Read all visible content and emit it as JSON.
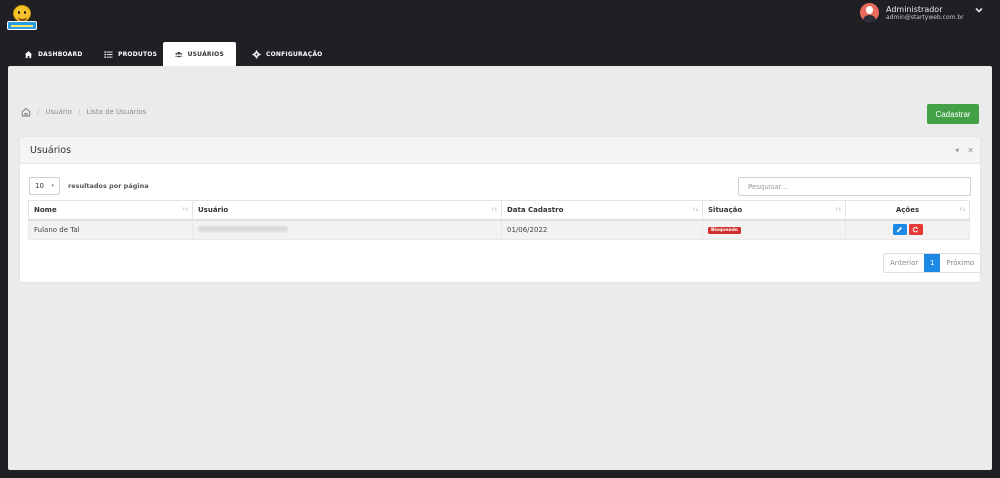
{
  "app": {
    "logo_name": "app-logo"
  },
  "user": {
    "name": "Administrador",
    "email": "admin@startyweb.com.br"
  },
  "nav": {
    "tabs": [
      {
        "label": "DASHBOARD",
        "icon": "home-icon"
      },
      {
        "label": "PRODUTOS",
        "icon": "list-icon"
      },
      {
        "label": "USUÁRIOS",
        "icon": "users-icon",
        "active": true
      },
      {
        "label": "CONFIGURAÇÃO",
        "icon": "gear-icon"
      }
    ]
  },
  "breadcrumb": {
    "items": [
      "Usuário",
      "Lista de Usuários"
    ]
  },
  "actions": {
    "cadastrar_label": "Cadastrar"
  },
  "card": {
    "title": "Usuários",
    "tools": {
      "collapse": "▾",
      "close": "✕"
    }
  },
  "table_controls": {
    "page_length": "10",
    "page_length_label": "resultados por página",
    "search_placeholder": "Pesquisar..."
  },
  "table": {
    "columns": [
      "Nome",
      "Usuário",
      "Data Cadastro",
      "Situação",
      "Ações"
    ],
    "rows": [
      {
        "nome": "Fulano de Tal",
        "usuario": "",
        "data": "01/06/2022",
        "situacao": "Bloqueado"
      }
    ]
  },
  "pagination": {
    "prev": "Anterior",
    "current": "1",
    "next": "Próximo"
  },
  "colors": {
    "accent": "#1e88e5",
    "success": "#43a047",
    "danger": "#d32f2f",
    "topbar": "#1f1f24"
  }
}
